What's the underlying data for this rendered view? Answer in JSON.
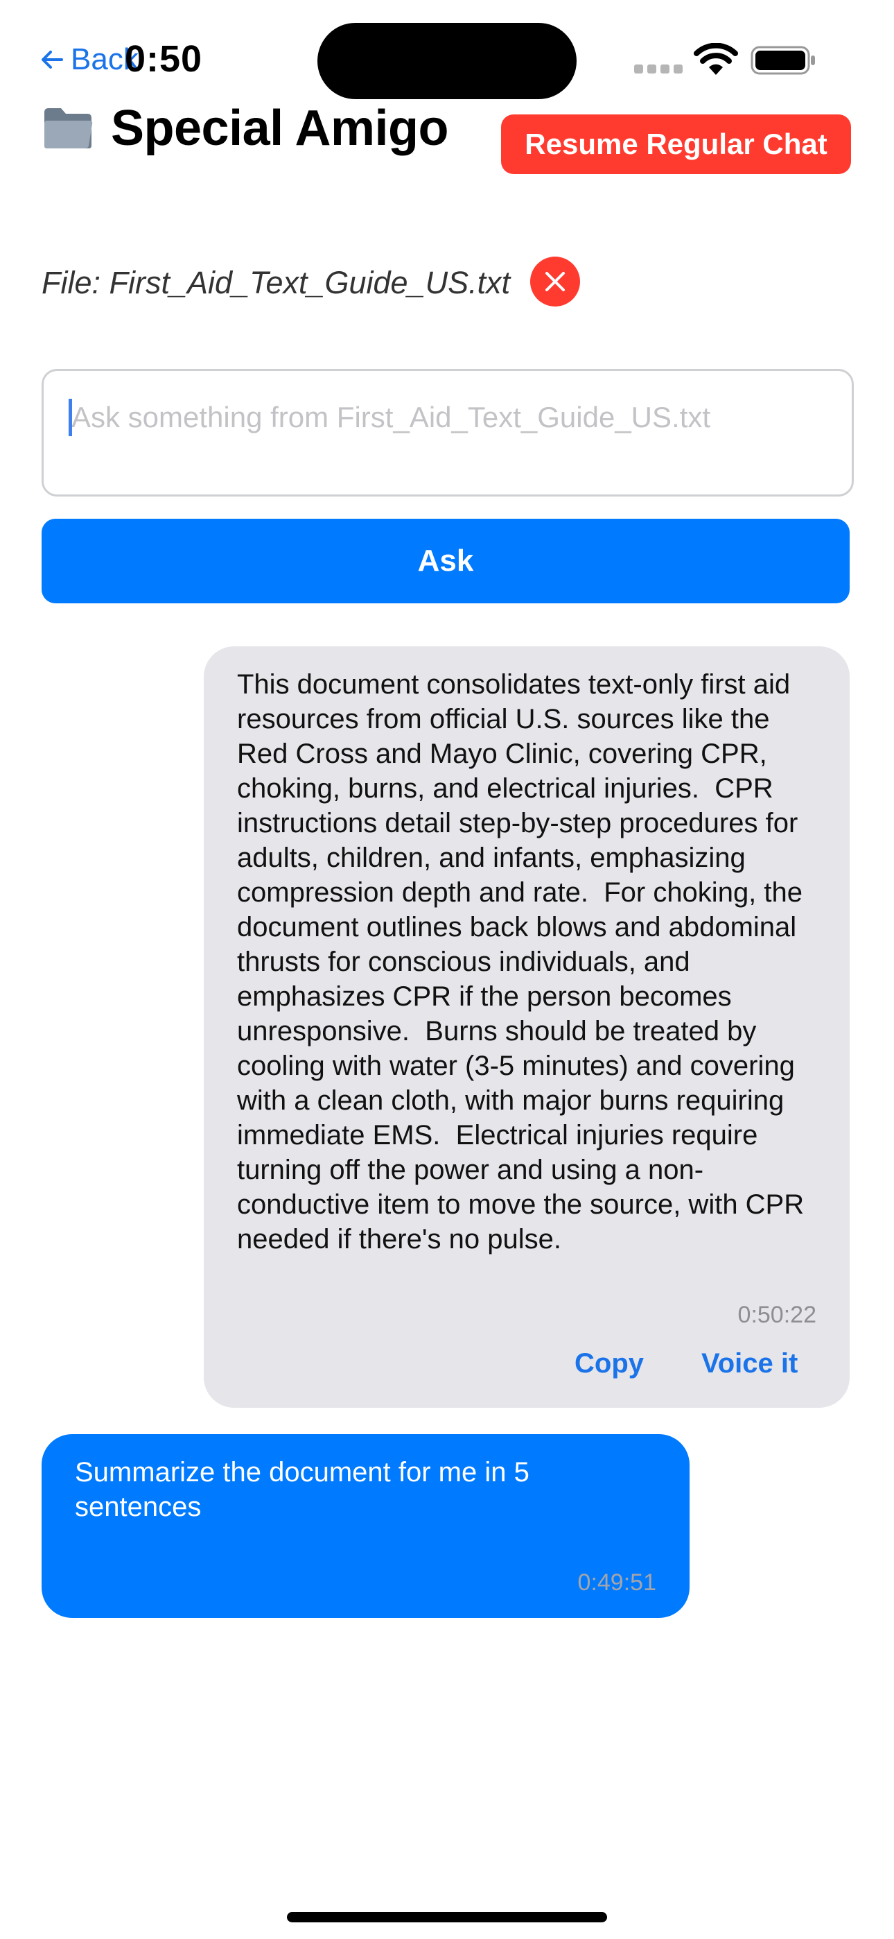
{
  "status_bar": {
    "time": "0:50",
    "icons": [
      "cellular-signal-icon",
      "wifi-icon",
      "battery-icon"
    ]
  },
  "nav": {
    "back_label": "Back",
    "back_icon": "arrow-left-icon"
  },
  "header": {
    "title": "Special Amigo",
    "title_icon": "folder-icon",
    "resume_label": "Resume Regular Chat"
  },
  "file": {
    "label": "File: First_Aid_Text_Guide_US.txt",
    "remove_icon": "close-circle-icon"
  },
  "input": {
    "placeholder": "Ask something from First_Aid_Text_Guide_US.txt",
    "value": ""
  },
  "ask_label": "Ask",
  "messages": [
    {
      "role": "assistant",
      "text": "This document consolidates text-only first aid resources from official U.S. sources like the Red Cross and Mayo Clinic, covering CPR, choking, burns, and electrical injuries.  CPR instructions detail step-by-step procedures for adults, children, and infants, emphasizing compression depth and rate.  For choking, the document outlines back blows and abdominal thrusts for conscious individuals, and emphasizes CPR if the person becomes unresponsive.  Burns should be treated by cooling with water (3-5 minutes) and covering with a clean cloth, with major burns requiring immediate EMS.  Electrical injuries require turning off the power and using a non-conductive item to move the source, with CPR needed if there's no pulse.",
      "time": "0:50:22",
      "actions": [
        "Copy",
        "Voice it"
      ]
    },
    {
      "role": "user",
      "text": "Summarize the document for me in 5 sentences",
      "time": "0:49:51"
    }
  ],
  "colors": {
    "accent_blue": "#007aff",
    "link_blue": "#1a73e8",
    "destructive_red": "#ff3b30",
    "bubble_gray": "#e5e5ea"
  }
}
